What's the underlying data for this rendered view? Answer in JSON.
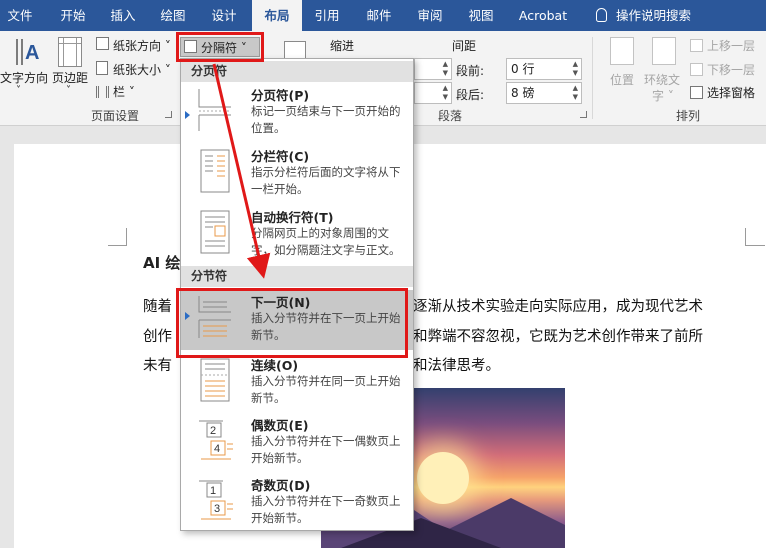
{
  "tabs": [
    "文件",
    "开始",
    "插入",
    "绘图",
    "设计",
    "布局",
    "引用",
    "邮件",
    "审阅",
    "视图",
    "Acrobat"
  ],
  "active_tab": "布局",
  "tell_me": "操作说明搜索",
  "ribbon": {
    "text_direction": [
      "文字方向",
      "˅"
    ],
    "margins": [
      "页边距",
      "˅"
    ],
    "orientation": "纸张方向 ˅",
    "size": "纸张大小 ˅",
    "columns": "栏 ˅",
    "breaks": "分隔符 ˅",
    "page_setup_label": "页面设置",
    "indent_label": "缩进",
    "spacing_label": "间距",
    "before_label": "段前:",
    "before_value": "0 行",
    "after_label": "段后:",
    "after_value": "8 磅",
    "paragraph_label": "段落",
    "position": "位置",
    "wrap_text": [
      "环绕文",
      "字 ˅"
    ],
    "bring_forward": "上移一层",
    "send_backward": "下移一层",
    "selection_pane": "选择窗格",
    "arrange_label": "排列"
  },
  "dropdown": {
    "page_breaks_header": "分页符",
    "section_breaks_header": "分节符",
    "items": [
      {
        "title": "分页符(P)",
        "desc": "标记一页结束与下一页开始的位置。"
      },
      {
        "title": "分栏符(C)",
        "desc": "指示分栏符后面的文字将从下一栏开始。"
      },
      {
        "title": "自动换行符(T)",
        "desc": "分隔网页上的对象周围的文字，如分隔题注文字与正文。"
      },
      {
        "title": "下一页(N)",
        "desc": "插入分节符并在下一页上开始新节。"
      },
      {
        "title": "连续(O)",
        "desc": "插入分节符并在同一页上开始新节。"
      },
      {
        "title": "偶数页(E)",
        "desc": "插入分节符并在下一偶数页上开始新节。"
      },
      {
        "title": "奇数页(D)",
        "desc": "插入分节符并在下一奇数页上开始新节。"
      }
    ]
  },
  "document": {
    "heading": "AI 绘",
    "line1_left": "随着",
    "line1_right": "逐渐从技术实验走向实际应用，成为现代艺术",
    "line2_left": "创作",
    "line2_right": "和弊端不容忽视，它既为艺术创作带来了前所",
    "line3_left": "未有",
    "line3_right": "和法律思考。"
  },
  "colors": {
    "tab_bar": "#2b579a",
    "annotation_red": "#e01818",
    "highlight": "#c8c8c8"
  }
}
